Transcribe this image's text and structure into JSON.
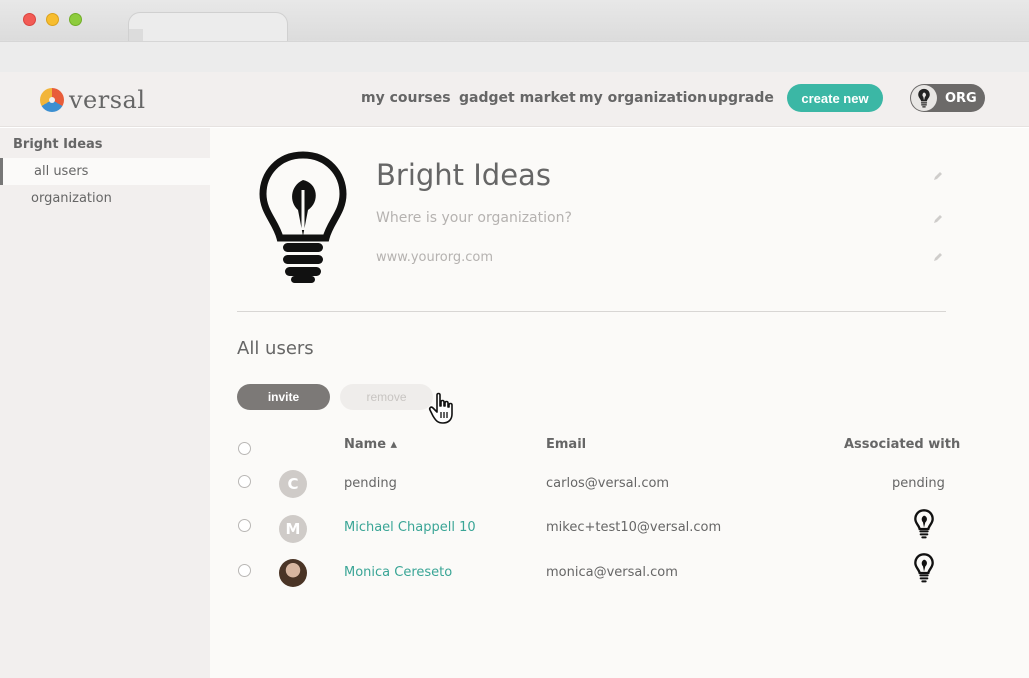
{
  "header": {
    "logo_text": "versal",
    "nav": [
      "my courses",
      "gadget market",
      "my organization",
      "upgrade"
    ],
    "create_label": "create new",
    "org_label": "ORG"
  },
  "sidebar": {
    "title": "Bright Ideas",
    "items": [
      {
        "label": "all users",
        "active": true
      },
      {
        "label": "organization",
        "active": false
      }
    ]
  },
  "org": {
    "name": "Bright Ideas",
    "location_placeholder": "Where is your organization?",
    "url_placeholder": "www.yourorg.com"
  },
  "users": {
    "section_title": "All users",
    "invite_label": "invite",
    "remove_label": "remove",
    "columns": {
      "name": "Name ▴",
      "email": "Email",
      "associated": "Associated with"
    },
    "rows": [
      {
        "initial": "C",
        "name": "pending",
        "email": "carlos@versal.com",
        "associated": "pending",
        "name_is_link": false
      },
      {
        "initial": "M",
        "name": "Michael Chappell 10",
        "email": "mikec+test10@versal.com",
        "associated": "",
        "name_is_link": true
      },
      {
        "initial": "",
        "name": "Monica Cereseto",
        "email": "monica@versal.com",
        "associated": "",
        "name_is_link": true
      }
    ]
  },
  "colors": {
    "accent": "#3bb7a5",
    "link": "#3aa596",
    "sidebar_bg": "#f2efee"
  }
}
